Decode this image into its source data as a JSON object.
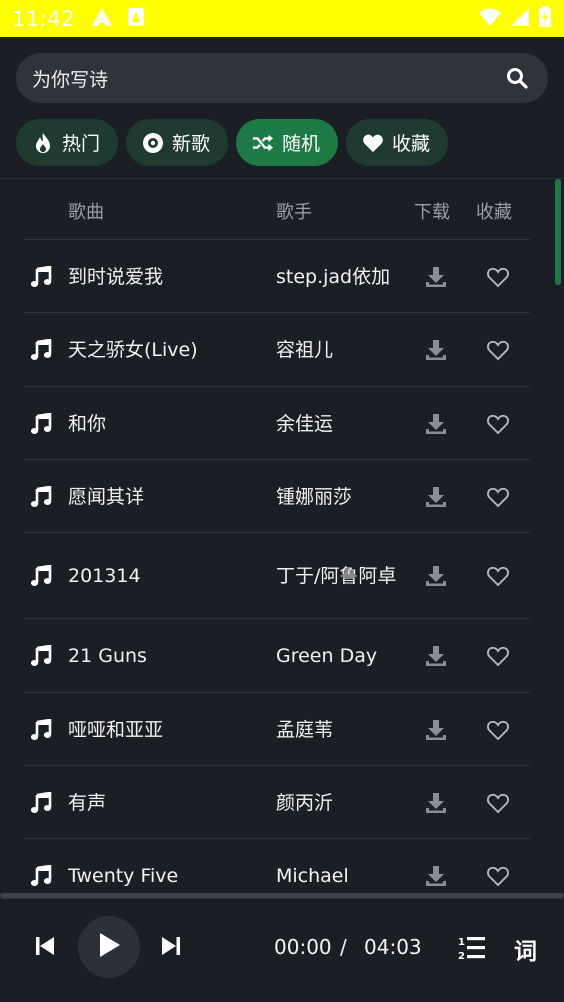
{
  "status": {
    "time": "11:42"
  },
  "search": {
    "value": "为你写诗",
    "placeholder": ""
  },
  "tabs": [
    {
      "label": "热门",
      "icon": "fire-icon",
      "active": false
    },
    {
      "label": "新歌",
      "icon": "disc-icon",
      "active": false
    },
    {
      "label": "随机",
      "icon": "shuffle-icon",
      "active": true
    },
    {
      "label": "收藏",
      "icon": "heart-icon",
      "active": false
    }
  ],
  "table": {
    "headers": {
      "song": "歌曲",
      "singer": "歌手",
      "download": "下载",
      "favorite": "收藏"
    },
    "rows": [
      {
        "song": "到时说爱我",
        "singer": "step.jad依加"
      },
      {
        "song": "天之骄女(Live)",
        "singer": "容祖儿"
      },
      {
        "song": "和你",
        "singer": "余佳运"
      },
      {
        "song": "愿闻其详",
        "singer": "锺娜丽莎"
      },
      {
        "song": "201314",
        "singer": "丁于/阿鲁阿卓"
      },
      {
        "song": "21 Guns",
        "singer": "Green Day"
      },
      {
        "song": "哑哑和亚亚",
        "singer": "孟庭苇"
      },
      {
        "song": "有声",
        "singer": "颜丙沂"
      },
      {
        "song": "Twenty Five",
        "singer": "Michael"
      }
    ]
  },
  "player": {
    "current_time": "00:00",
    "separator": "/",
    "total_time": "04:03",
    "lyrics_label": "词"
  },
  "colors": {
    "accent": "#1e7a45",
    "background": "#1b1e25",
    "status_bar": "#ffff00"
  }
}
